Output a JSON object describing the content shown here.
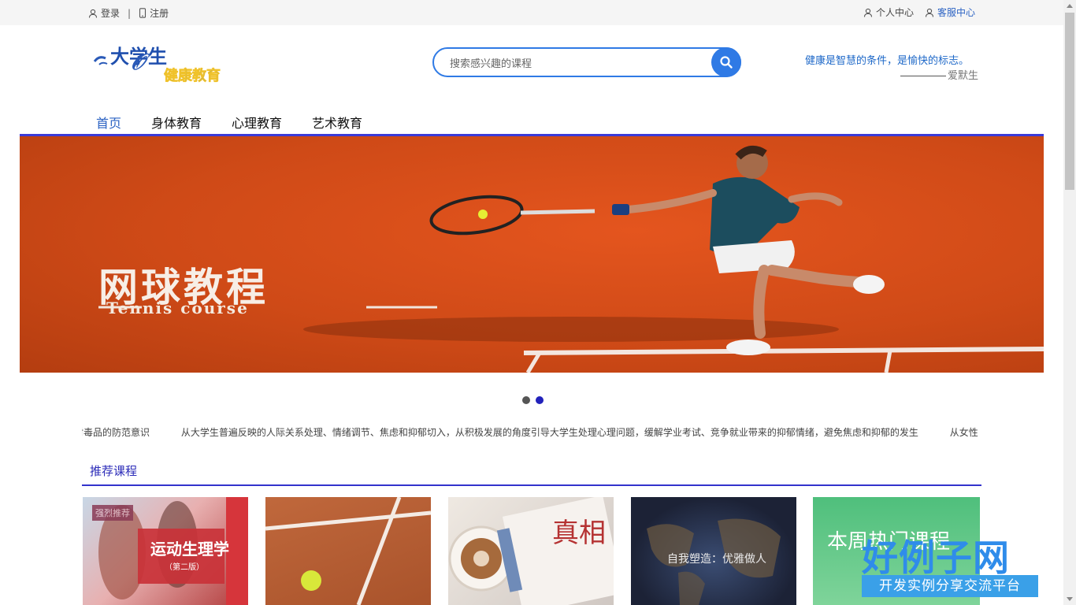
{
  "topbar": {
    "login": "登录",
    "separator": "|",
    "register": "注册",
    "personal_center": "个人中心",
    "customer_service": "客服中心"
  },
  "logo": {
    "line1": "大学生",
    "line2": "健康教育"
  },
  "search": {
    "placeholder": "搜索感兴趣的课程",
    "icon": "search-icon"
  },
  "slogan": {
    "quote": "健康是智慧的条件，是愉快的标志。",
    "author": "爱默生"
  },
  "nav": {
    "items": [
      "首页",
      "身体教育",
      "心理教育",
      "艺术教育"
    ],
    "active_index": 0
  },
  "banner": {
    "title": "网球教程",
    "subtitle": "Tennis course",
    "slide_count": 2,
    "active_slide": 1
  },
  "marquee": {
    "items": [
      "对毒品的防范意识",
      "从大学生普遍反映的人际关系处理、情绪调节、焦虑和抑郁切入，从积极发展的角度引导大学生处理心理问题，缓解学业考试、竞争就业带来的抑郁情绪，避免焦虑和抑郁的发生",
      "从女性"
    ]
  },
  "recommended": {
    "title": "推荐课程",
    "cards": [
      {
        "tag": "强烈推荐",
        "text": "运动生理学",
        "sub": "（第二版）"
      },
      {
        "text": ""
      },
      {
        "text": "真相"
      },
      {
        "text": "自我塑造：优雅做人"
      },
      {
        "text": "本周热门课程"
      }
    ]
  },
  "watermark": {
    "big": "好例子网",
    "small": "开发实例分享交流平台"
  },
  "colors": {
    "accent": "#2f7ae5",
    "nav_line": "#3a3ad8",
    "banner": "#d14b18"
  }
}
